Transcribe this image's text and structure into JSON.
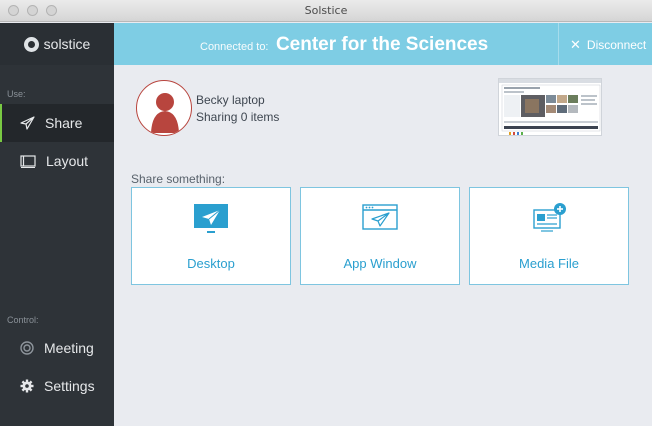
{
  "window": {
    "title": "Solstice"
  },
  "sidebar": {
    "logo_text": "solstice",
    "use_label": "Use:",
    "control_label": "Control:",
    "items": [
      {
        "label": "Share",
        "icon": "paper-plane-icon",
        "active": true
      },
      {
        "label": "Layout",
        "icon": "layout-icon",
        "active": false
      },
      {
        "label": "Meeting",
        "icon": "meeting-icon",
        "active": false
      },
      {
        "label": "Settings",
        "icon": "gear-icon",
        "active": false
      }
    ],
    "accent_color": "#79c943"
  },
  "header": {
    "connected_label": "Connected to:",
    "room_name": "Center for the Sciences",
    "disconnect_label": "Disconnect",
    "background_color": "#7ecde4"
  },
  "user": {
    "name": "Becky laptop",
    "status": "Sharing 0 items",
    "avatar_color": "#b8453e"
  },
  "share": {
    "label": "Share something:",
    "options": [
      {
        "label": "Desktop",
        "icon": "desktop-share-icon"
      },
      {
        "label": "App Window",
        "icon": "app-window-share-icon"
      },
      {
        "label": "Media File",
        "icon": "media-file-add-icon"
      }
    ],
    "accent_color": "#2a9fcf"
  }
}
